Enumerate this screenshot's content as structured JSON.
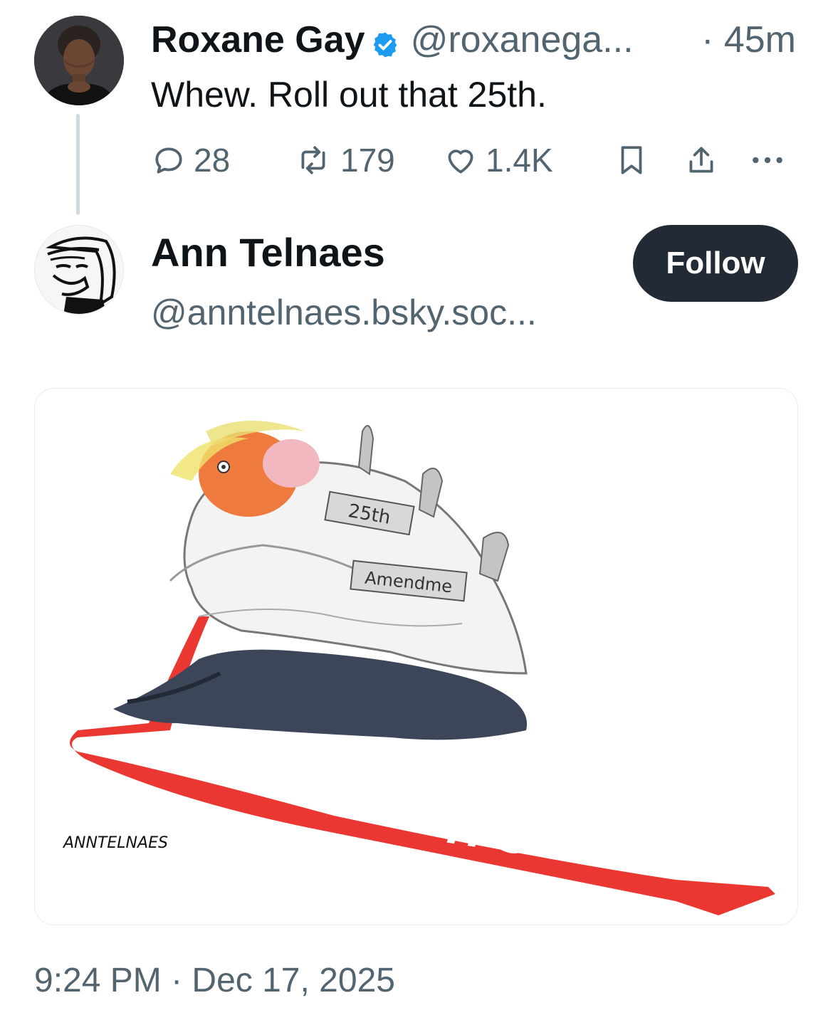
{
  "original_tweet": {
    "display_name": "Roxane Gay",
    "handle": "@roxanega...",
    "time": "· 45m",
    "text": "Whew. Roll out that 25th.",
    "replies": "28",
    "reposts": "179",
    "likes": "1.4K",
    "icons": [
      "comment-icon",
      "repost-icon",
      "heart-icon",
      "bookmark-icon",
      "share-icon",
      "more-icon"
    ]
  },
  "quoted_account": {
    "display_name": "Ann Telnaes",
    "handle": "@anntelnaes.bsky.soc...",
    "follow_label": "Follow"
  },
  "cartoon": {
    "label_top": "25th",
    "label_bottom": "Amendme",
    "tie_text": "IT'S TIME",
    "signature": "ANNTELNAES"
  },
  "timestamp": "9:24 PM · Dec 17, 2025",
  "colors": {
    "verified": "#1d9bf0",
    "follow_button": "#222a35",
    "secondary_text": "#536471",
    "tie_red": "#e8261f"
  }
}
